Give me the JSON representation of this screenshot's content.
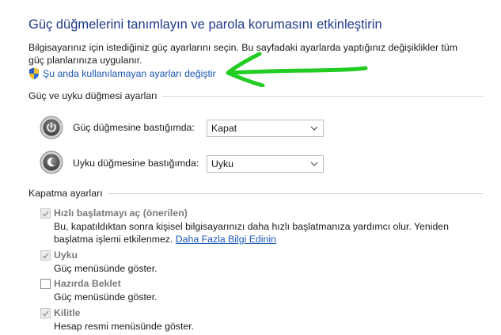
{
  "page": {
    "title": "Güç düğmelerini tanımlayın ve parola korumasını etkinleştirin",
    "description": "Bilgisayarınız için istediğiniz güç ayarlarını seçin. Bu sayfadaki ayarlarda yaptığınız değişiklikler tüm güç planlarınıza uygulanır.",
    "change_link": "Şu anda kullanılamayan ayarları değiştir"
  },
  "power_section": {
    "label": "Güç ve uyku düğmesi ayarları",
    "rows": [
      {
        "label": "Güç düğmesine bastığımda:",
        "value": "Kapat"
      },
      {
        "label": "Uyku düğmesine bastığımda:",
        "value": "Uyku"
      }
    ]
  },
  "shutdown_section": {
    "label": "Kapatma ayarları",
    "items": [
      {
        "label": "Hızlı başlatmayı aç (önerilen)",
        "checked": true,
        "disabled": true,
        "desc": "Bu, kapatıldıktan sonra kişisel bilgisayarınızı daha hızlı başlatmanıza yardımcı olur. Yeniden başlatma işlemi etkilenmez.",
        "link": "Daha Fazla Bilgi Edinin"
      },
      {
        "label": "Uyku",
        "checked": true,
        "disabled": true,
        "desc": "Güç menüsünde göster."
      },
      {
        "label": "Hazırda Beklet",
        "checked": false,
        "disabled": true,
        "desc": "Güç menüsünde göster."
      },
      {
        "label": "Kilitle",
        "checked": true,
        "disabled": true,
        "desc": "Hesap resmi menüsünde göster."
      }
    ]
  },
  "colors": {
    "title": "#1e3a8a",
    "link": "#1a56b4",
    "annotation_arrow": "#22cc22",
    "disabled_text": "#7a7a7a"
  }
}
